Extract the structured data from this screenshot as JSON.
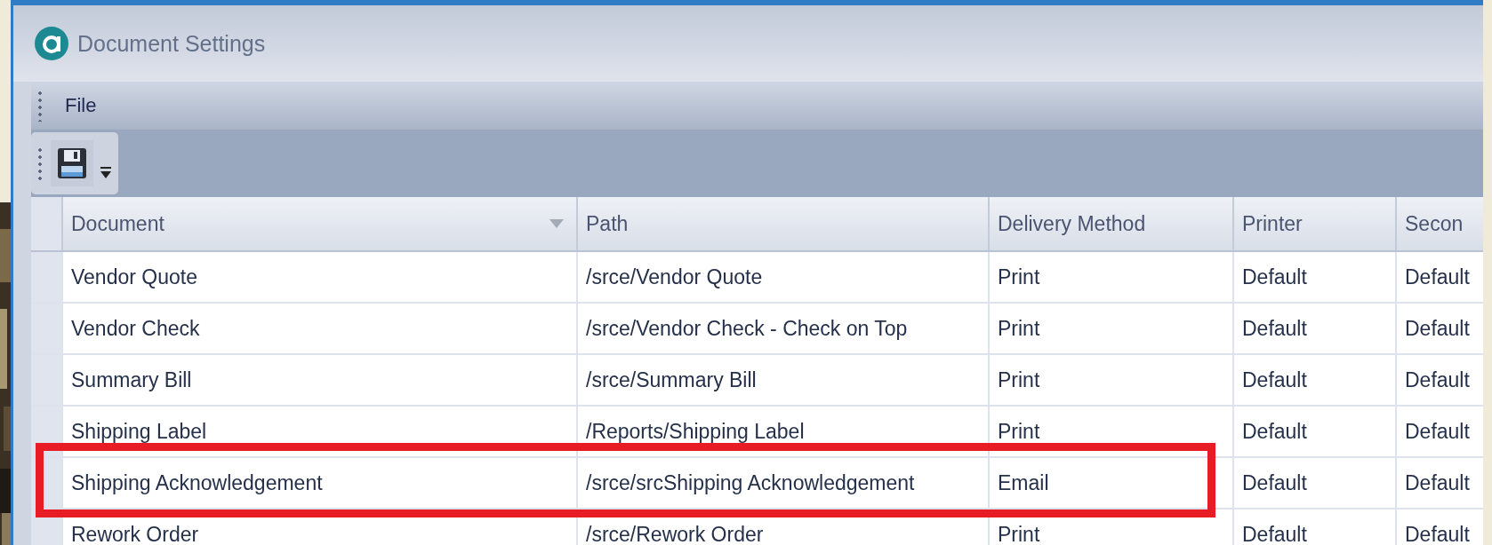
{
  "window": {
    "title": "Document Settings"
  },
  "menu": [
    {
      "label": "File"
    }
  ],
  "table": {
    "columns": [
      {
        "label": "Document",
        "sorted": true
      },
      {
        "label": "Path",
        "sorted": false
      },
      {
        "label": "Delivery Method",
        "sorted": false
      },
      {
        "label": "Printer",
        "sorted": false
      },
      {
        "label": "Secon",
        "sorted": false
      }
    ],
    "rows": [
      {
        "cells": [
          "Vendor Quote",
          "/srce/Vendor Quote",
          "Print",
          "Default",
          "Default"
        ],
        "highlighted": false
      },
      {
        "cells": [
          "Vendor Check",
          "/srce/Vendor Check - Check on Top",
          "Print",
          "Default",
          "Default"
        ],
        "highlighted": false
      },
      {
        "cells": [
          "Summary Bill",
          "/srce/Summary Bill",
          "Print",
          "Default",
          "Default"
        ],
        "highlighted": false
      },
      {
        "cells": [
          "Shipping Label",
          "/Reports/Shipping Label",
          "Print",
          "Default",
          "Default"
        ],
        "highlighted": false
      },
      {
        "cells": [
          "Shipping Acknowledgement",
          "/srce/srcShipping Acknowledgement",
          "Email",
          "Default",
          "Default"
        ],
        "highlighted": true
      },
      {
        "cells": [
          "Rework Order",
          "/srce/Rework Order",
          "Print",
          "Default",
          "Default"
        ],
        "highlighted": false
      }
    ]
  }
}
